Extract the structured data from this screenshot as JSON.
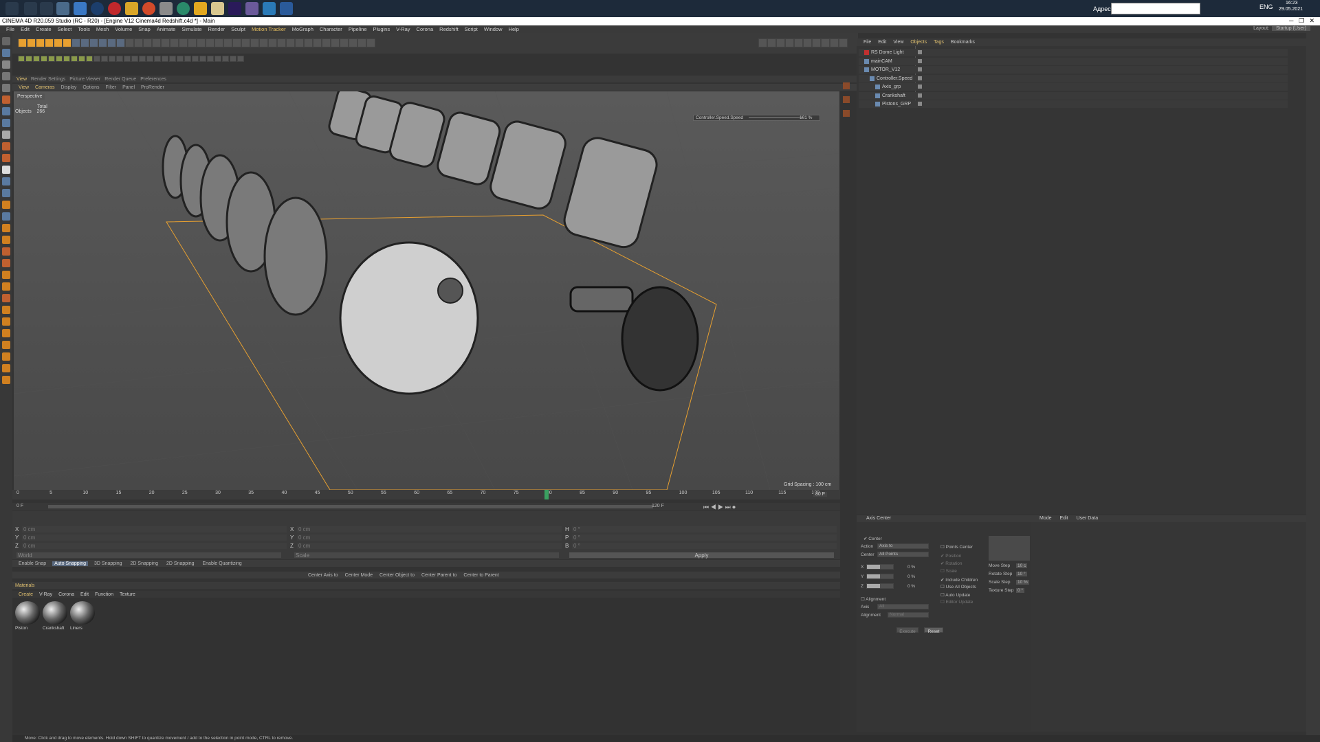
{
  "taskbar": {
    "address_label": "Адрес",
    "language": "ENG",
    "time": "16:23",
    "date": "29.05.2021"
  },
  "titlebar": {
    "title": "CINEMA 4D R20.059 Studio (RC - R20) - [Engine V12 Cinema4d Redshift.c4d *] - Main"
  },
  "menubar": {
    "items": [
      "File",
      "Edit",
      "Create",
      "Select",
      "Tools",
      "Mesh",
      "Volume",
      "Snap",
      "Animate",
      "Simulate",
      "Render",
      "Sculpt",
      "Motion Tracker",
      "MoGraph",
      "Character",
      "Pipeline",
      "Plugins",
      "V-Ray",
      "Corona",
      "Redshift",
      "Script",
      "Window",
      "Help"
    ],
    "layout_label": "Layout:",
    "layout_value": "Startup (User)"
  },
  "viewport": {
    "tabs": [
      "View",
      "Render Settings",
      "Picture Viewer",
      "Render Queue",
      "Preferences"
    ],
    "menu": [
      "View",
      "Cameras",
      "Display",
      "Options",
      "Filter",
      "Panel",
      "ProRender"
    ],
    "label": "Perspective",
    "stats_header": "Total",
    "stats_label": "Objects",
    "stats_value": "266",
    "hud_label": "Controller.Speed.Speed",
    "hud_value": "101 %",
    "grid_spacing": "Grid Spacing : 100 cm"
  },
  "timeline": {
    "ticks": [
      "0",
      "5",
      "10",
      "15",
      "20",
      "25",
      "30",
      "35",
      "40",
      "45",
      "50",
      "55",
      "60",
      "65",
      "70",
      "75",
      "80",
      "85",
      "90",
      "95",
      "100",
      "105",
      "110",
      "115",
      "120"
    ],
    "current": "80 F",
    "start": "0 F",
    "range_start": "0 F",
    "range_end": "120 F",
    "end": "120 F"
  },
  "coords": {
    "rows": [
      {
        "a": "X",
        "av": "0 cm",
        "b": "X",
        "bv": "0 cm",
        "c": "H",
        "cv": "0 °"
      },
      {
        "a": "Y",
        "av": "0 cm",
        "b": "Y",
        "bv": "0 cm",
        "c": "P",
        "cv": "0 °"
      },
      {
        "a": "Z",
        "av": "0 cm",
        "b": "Z",
        "bv": "0 cm",
        "c": "B",
        "cv": "0 °"
      }
    ],
    "mode1": "World",
    "mode2": "Scale",
    "apply": "Apply"
  },
  "snapping": {
    "items": [
      "Enable Snap",
      "Auto Snapping",
      "3D Snapping",
      "2D Snapping",
      "2D Snapping",
      "Enable Quantizing"
    ],
    "axis_items": [
      "Center Axis to",
      "Center Mode",
      "Center Object to",
      "Center Parent to",
      "Center to Parent"
    ]
  },
  "materials": {
    "tab": "Materials",
    "menu": [
      "Create",
      "V-Ray",
      "Corona",
      "Edit",
      "Function",
      "Texture"
    ],
    "items": [
      "Piston",
      "Crankshaft",
      "Liners"
    ]
  },
  "objects": {
    "menu": [
      "File",
      "Edit",
      "View",
      "Objects",
      "Tags",
      "Bookmarks"
    ],
    "tree": [
      {
        "name": "RS Dome Light",
        "indent": 0
      },
      {
        "name": "mainCAM",
        "indent": 0
      },
      {
        "name": "MOTOR_V12",
        "indent": 0
      },
      {
        "name": "Controller.Speed",
        "indent": 1
      },
      {
        "name": "Axis_grp",
        "indent": 2
      },
      {
        "name": "Crankshaft",
        "indent": 2
      },
      {
        "name": "Pistons_GRP",
        "indent": 2
      }
    ]
  },
  "axis_center": {
    "title": "Axis Center",
    "center_label": "Center",
    "action_label": "Action",
    "action_value": "Axis to",
    "center_field_label": "Center",
    "center_value": "All Points",
    "xyz": [
      {
        "axis": "X",
        "value": "0 %"
      },
      {
        "axis": "Y",
        "value": "0 %"
      },
      {
        "axis": "Z",
        "value": "0 %"
      }
    ],
    "points_center": "Points Center",
    "position": "Position",
    "rotation": "Rotation",
    "scale": "Scale",
    "include_children": "Include Children",
    "use_all_objects": "Use All Objects",
    "auto_update": "Auto Update",
    "editor_update": "Editor Update",
    "alignment": "Alignment",
    "axis_label": "Axis",
    "axis_value": "All",
    "alignment_label": "Alignment",
    "alignment_value": "Normal",
    "execute": "Execute",
    "reset": "Reset",
    "steps": [
      {
        "label": "Move Step",
        "value": "10 c"
      },
      {
        "label": "Rotate Step",
        "value": "10 °"
      },
      {
        "label": "Scale Step",
        "value": "10 %"
      },
      {
        "label": "Texture Step",
        "value": "0 °"
      }
    ]
  },
  "attributes": {
    "menu": [
      "Mode",
      "Edit",
      "User Data"
    ]
  },
  "status": {
    "text": "Move: Click and drag to move elements. Hold down SHIFT to quantize movement / add to the selection in point mode, CTRL to remove."
  }
}
